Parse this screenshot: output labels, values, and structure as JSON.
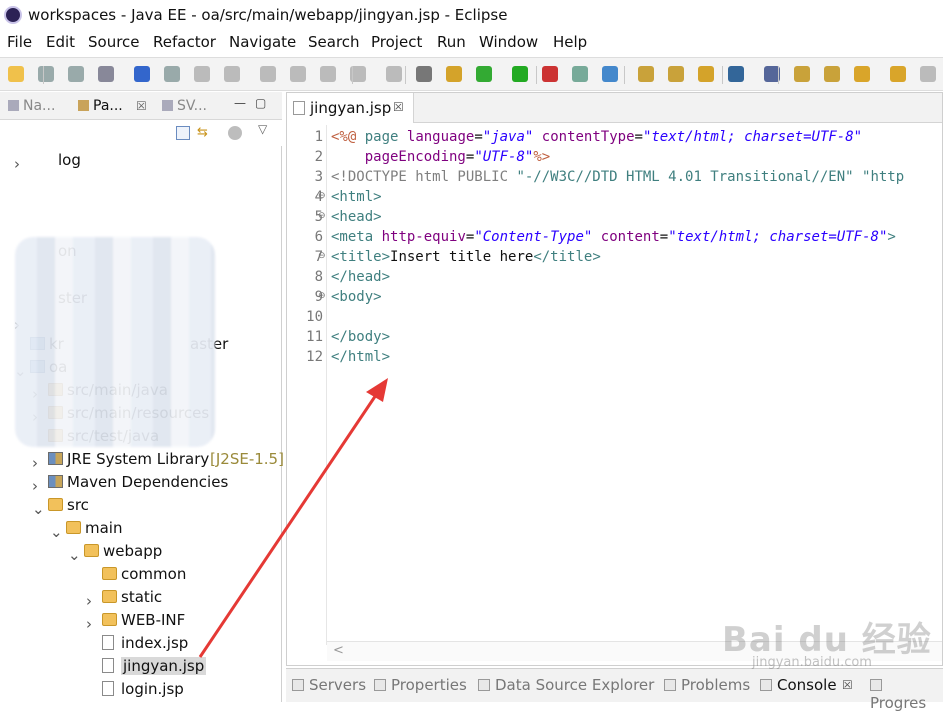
{
  "window": {
    "title": "workspaces - Java EE - oa/src/main/webapp/jingyan.jsp - Eclipse"
  },
  "menu": [
    "File",
    "Edit",
    "Source",
    "Refactor",
    "Navigate",
    "Search",
    "Project",
    "Run",
    "Window",
    "Help"
  ],
  "left_tabs": [
    {
      "label": "Na..."
    },
    {
      "label": "Pa...",
      "active": true
    },
    {
      "label": "SV..."
    }
  ],
  "tree": [
    {
      "label": "log",
      "depth": 0,
      "twisty": ">",
      "icon": "none"
    },
    {
      "label": "on",
      "depth": 0,
      "twisty": "",
      "icon": "none"
    },
    {
      "label": "ster",
      "depth": 0,
      "twisty": "",
      "icon": "none"
    },
    {
      "label": "",
      "depth": 0,
      "twisty": ">",
      "icon": "none"
    },
    {
      "label": "kr",
      "suffix": "aster",
      "depth": 0,
      "twisty": "",
      "icon": "proj"
    },
    {
      "label": "oa",
      "depth": 0,
      "twisty": "v",
      "icon": "proj"
    },
    {
      "label": "src/main/java",
      "depth": 1,
      "twisty": ">",
      "icon": "pkg"
    },
    {
      "label": "src/main/resources",
      "depth": 1,
      "twisty": ">",
      "icon": "pkg"
    },
    {
      "label": "src/test/java",
      "depth": 1,
      "twisty": "",
      "icon": "pkg"
    },
    {
      "label": "JRE System Library",
      "deco": "[J2SE-1.5]",
      "depth": 1,
      "twisty": ">",
      "icon": "lib"
    },
    {
      "label": "Maven Dependencies",
      "depth": 1,
      "twisty": ">",
      "icon": "lib"
    },
    {
      "label": "src",
      "depth": 1,
      "twisty": "v",
      "icon": "folder"
    },
    {
      "label": "main",
      "depth": 2,
      "twisty": "v",
      "icon": "folder"
    },
    {
      "label": "webapp",
      "depth": 3,
      "twisty": "v",
      "icon": "folder"
    },
    {
      "label": "common",
      "depth": 4,
      "twisty": "",
      "icon": "folder"
    },
    {
      "label": "static",
      "depth": 4,
      "twisty": ">",
      "icon": "folder"
    },
    {
      "label": "WEB-INF",
      "depth": 4,
      "twisty": ">",
      "icon": "folder"
    },
    {
      "label": "index.jsp",
      "depth": 4,
      "twisty": "",
      "icon": "file"
    },
    {
      "label": "jingyan.jsp",
      "depth": 4,
      "twisty": "",
      "icon": "file",
      "selected": true
    },
    {
      "label": "login.jsp",
      "depth": 4,
      "twisty": "",
      "icon": "file"
    }
  ],
  "editor": {
    "tab": "jingyan.jsp",
    "lines": [
      {
        "n": "1",
        "fold": "",
        "html": "<span class='d'>&lt;%@</span> <span class='t'>page</span> <span class='a'>language</span>=<span class='s'>\"java\"</span> <span class='a'>contentType</span>=<span class='s'>\"text/html; charset=UTF-8\"</span>"
      },
      {
        "n": "2",
        "fold": "",
        "html": "    <span class='a'>pageEncoding</span>=<span class='s'>\"UTF-8\"</span><span class='d'>%&gt;</span>"
      },
      {
        "n": "3",
        "fold": "",
        "html": "<span class='dt'>&lt;!DOCTYPE html PUBLIC </span><span class='t'>\"-//W3C//DTD HTML 4.01 Transitional//EN\" \"http</span>"
      },
      {
        "n": "4",
        "fold": "⊖",
        "html": "<span class='t'>&lt;html&gt;</span>"
      },
      {
        "n": "5",
        "fold": "⊖",
        "html": "<span class='t'>&lt;head&gt;</span>"
      },
      {
        "n": "6",
        "fold": "",
        "html": "<span class='t'>&lt;meta</span> <span class='a'>http-equiv</span>=<span class='s'>\"Content-Type\"</span> <span class='a'>content</span>=<span class='s'>\"text/html; charset=UTF-8\"</span><span class='t'>&gt;</span>"
      },
      {
        "n": "7",
        "fold": "⊖",
        "html": "<span class='t'>&lt;title&gt;</span>Insert title here<span class='t'>&lt;/title&gt;</span>"
      },
      {
        "n": "8",
        "fold": "",
        "html": "<span class='t'>&lt;/head&gt;</span>"
      },
      {
        "n": "9",
        "fold": "⊖",
        "html": "<span class='t'>&lt;body&gt;</span>"
      },
      {
        "n": "10",
        "fold": "",
        "html": ""
      },
      {
        "n": "11",
        "fold": "",
        "html": "<span class='t'>&lt;/body&gt;</span>"
      },
      {
        "n": "12",
        "fold": "",
        "html": "<span class='t'>&lt;/html&gt;</span>"
      }
    ]
  },
  "bottom_tabs": [
    {
      "label": "Servers"
    },
    {
      "label": "Properties"
    },
    {
      "label": "Data Source Explorer"
    },
    {
      "label": "Problems"
    },
    {
      "label": "Console",
      "active": true
    },
    {
      "label": "Progres"
    }
  ],
  "watermark": {
    "text": "Bai du 经验",
    "sub": "jingyan.baidu.com"
  }
}
